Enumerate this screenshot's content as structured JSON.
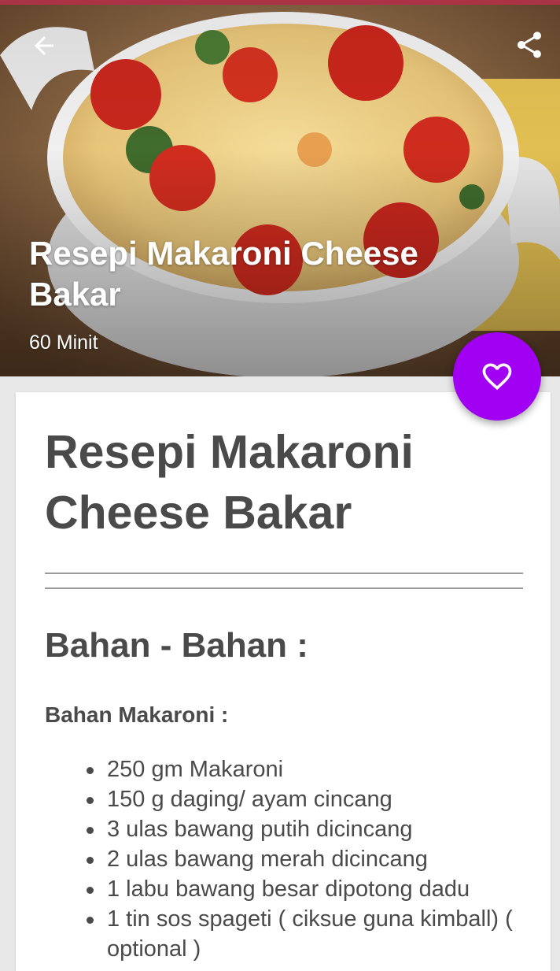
{
  "hero": {
    "title": "Resepi Makaroni Cheese Bakar",
    "time": "60 Minit"
  },
  "icons": {
    "back": "arrow-left-icon",
    "share": "share-icon",
    "favorite": "heart-outline-icon"
  },
  "colors": {
    "fab": "#a100f2",
    "text": "#4a4a4a"
  },
  "article": {
    "title": "Resepi Makaroni Cheese Bakar",
    "section_heading": "Bahan - Bahan :",
    "subheading": "Bahan Makaroni :",
    "ingredients": [
      "250 gm Makaroni",
      "150 g daging/ ayam cincang",
      "3 ulas bawang putih dicincang",
      "2 ulas bawang merah dicincang",
      "1 labu bawang besar dipotong dadu",
      "1 tin sos spageti ( ciksue guna kimball) ( optional )"
    ]
  }
}
